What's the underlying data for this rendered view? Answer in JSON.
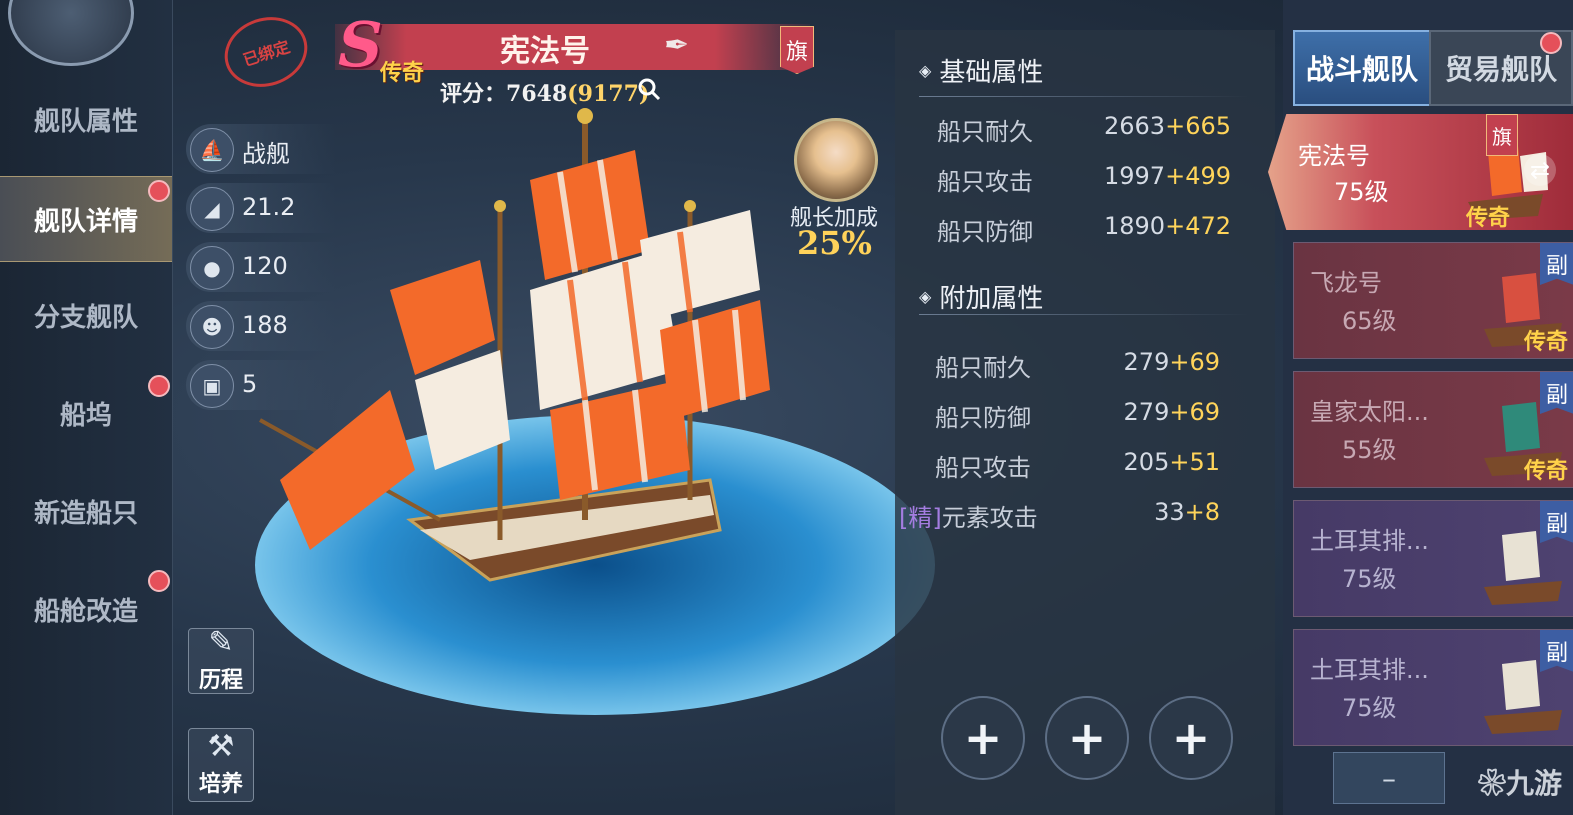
{
  "nav": {
    "items": [
      {
        "label": "舰队属性",
        "active": false,
        "dot": false
      },
      {
        "label": "舰队详情",
        "active": true,
        "dot": true
      },
      {
        "label": "分支舰队",
        "active": false,
        "dot": false
      },
      {
        "label": "船坞",
        "active": false,
        "dot": true
      },
      {
        "label": "新造船只",
        "active": false,
        "dot": false
      },
      {
        "label": "船舱改造",
        "active": false,
        "dot": true
      }
    ]
  },
  "header": {
    "bound_stamp": "已绑定",
    "rank_letter": "S",
    "rank_quality": "传奇",
    "ship_name": "宪法号",
    "flag_badge": "旗",
    "score_label": "评分：",
    "score_value": "7648",
    "score_extra": "(9177)"
  },
  "ship_stats": [
    {
      "icon": "warship-icon",
      "value": "战舰"
    },
    {
      "icon": "sail-icon",
      "value": "21.2"
    },
    {
      "icon": "supplies-icon",
      "value": "120"
    },
    {
      "icon": "sailor-icon",
      "value": "188"
    },
    {
      "icon": "cargo-icon",
      "value": "5"
    }
  ],
  "side_buttons": {
    "history": "历程",
    "cultivate": "培养"
  },
  "captain": {
    "label": "舰长加成",
    "bonus": "25%"
  },
  "base_attrs": {
    "title": "基础属性",
    "rows": [
      {
        "label": "船只耐久",
        "base": "2663",
        "bonus": "+665"
      },
      {
        "label": "船只攻击",
        "base": "1997",
        "bonus": "+499"
      },
      {
        "label": "船只防御",
        "base": "1890",
        "bonus": "+472"
      }
    ]
  },
  "extra_attrs": {
    "title": "附加属性",
    "rows": [
      {
        "prefix": "",
        "label": "船只耐久",
        "base": "279",
        "bonus": "+69"
      },
      {
        "prefix": "",
        "label": "船只防御",
        "base": "279",
        "bonus": "+69"
      },
      {
        "prefix": "",
        "label": "船只攻击",
        "base": "205",
        "bonus": "+51"
      },
      {
        "prefix": "[精]",
        "label": "元素攻击",
        "base": "33",
        "bonus": "+8"
      }
    ]
  },
  "tabs": {
    "battle": "战斗舰队",
    "trade": "贸易舰队"
  },
  "fleet": {
    "flagship": {
      "name": "宪法号",
      "level": "75级",
      "badge": "旗",
      "quality": "传奇"
    },
    "ships": [
      {
        "name": "飞龙号",
        "level": "65级",
        "badge": "副",
        "quality": "传奇",
        "tint": "#6a3442"
      },
      {
        "name": "皇家太阳...",
        "level": "55级",
        "badge": "副",
        "quality": "传奇",
        "tint": "#6a3442"
      },
      {
        "name": "土耳其排...",
        "level": "75级",
        "badge": "副",
        "quality": "",
        "tint": "#463a66"
      },
      {
        "name": "土耳其排...",
        "level": "75级",
        "badge": "副",
        "quality": "",
        "tint": "#463a66"
      }
    ]
  },
  "watermark": "九游",
  "colors": {
    "accent_gold": "#ffd45a",
    "banner_red": "#c2404f",
    "tab_blue": "#3e6fa9"
  }
}
